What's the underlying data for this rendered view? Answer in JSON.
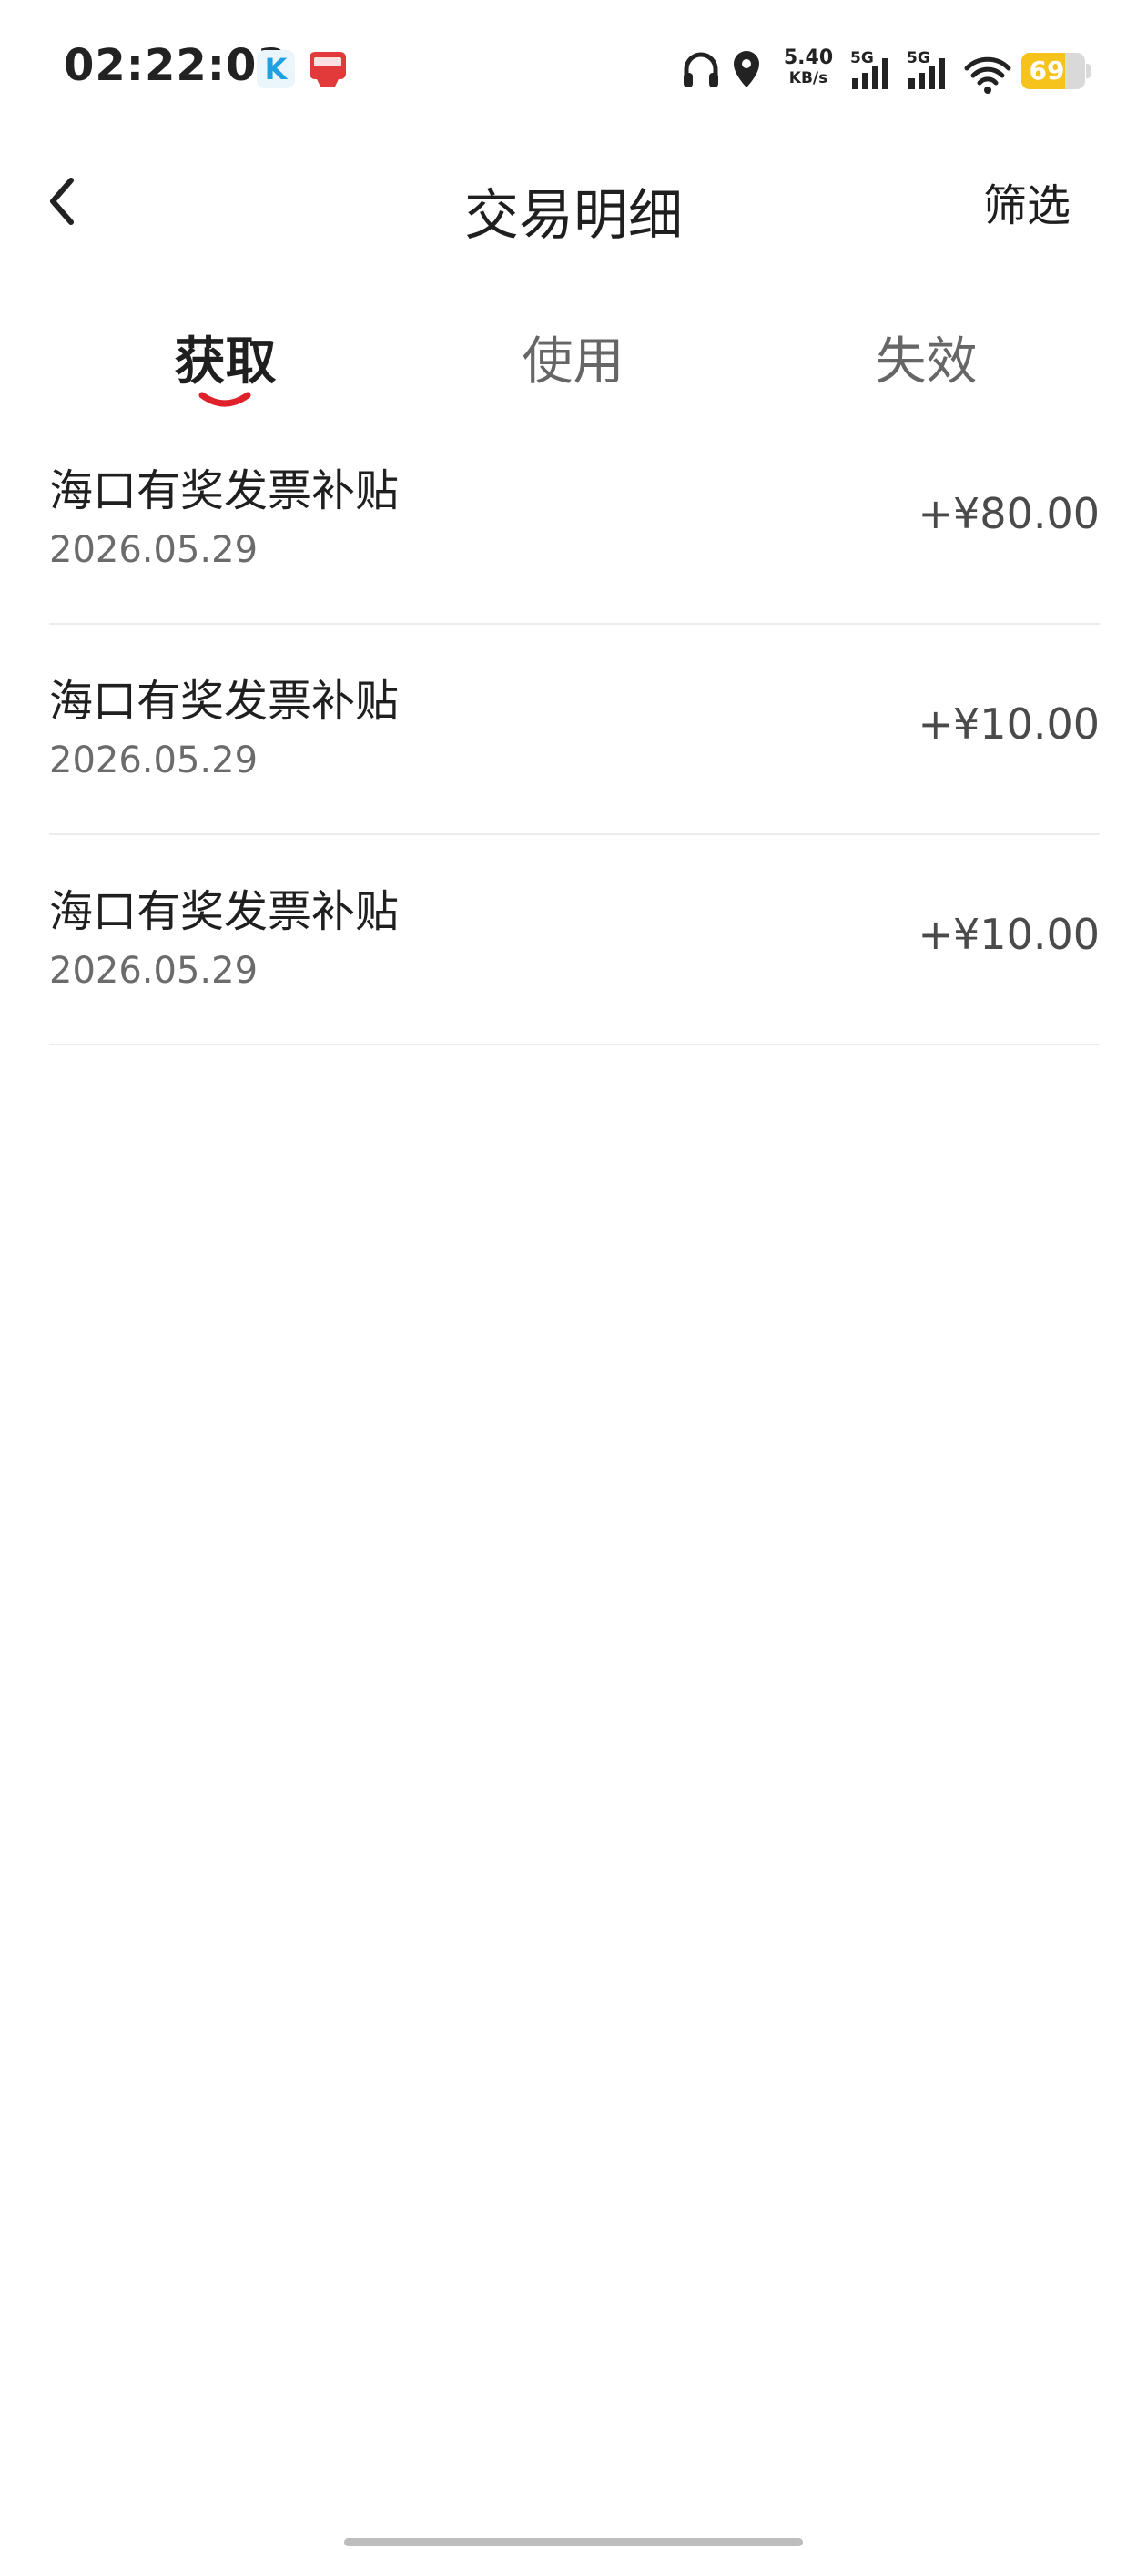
{
  "status_bar": {
    "time": "02:22:03",
    "app_icon_k": "K",
    "net_speed_value": "5.40",
    "net_speed_unit": "KB/s",
    "signal_1_type": "5G",
    "signal_2_type": "5G",
    "battery_level": "69",
    "battery_percent": 69,
    "icons": [
      "headset-icon",
      "location-icon",
      "signal-icon",
      "wifi-icon",
      "battery-icon"
    ],
    "battery_color": "#f6c21c"
  },
  "nav": {
    "back_icon": "chevron-left-icon",
    "title": "交易明细",
    "filter_label": "筛选"
  },
  "tabs": [
    {
      "label": "获取",
      "active": true
    },
    {
      "label": "使用",
      "active": false
    },
    {
      "label": "失效",
      "active": false
    }
  ],
  "accent_color": "#e0202a",
  "transactions": [
    {
      "name": "海口有奖发票补贴",
      "date": "2026.05.29",
      "amount": "+¥80.00"
    },
    {
      "name": "海口有奖发票补贴",
      "date": "2026.05.29",
      "amount": "+¥10.00"
    },
    {
      "name": "海口有奖发票补贴",
      "date": "2026.05.29",
      "amount": "+¥10.00"
    }
  ]
}
